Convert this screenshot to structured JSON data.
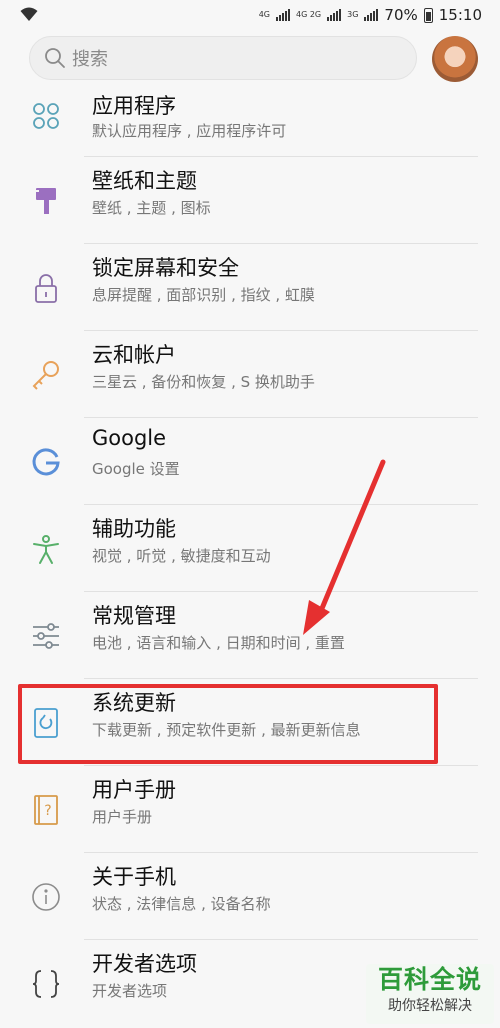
{
  "status_bar": {
    "network_top": "4G",
    "network_2": "4G 2G",
    "network_3": "3G",
    "battery": "70%",
    "time": "15:10"
  },
  "search": {
    "placeholder": "搜索"
  },
  "settings": [
    {
      "title": "应用程序",
      "subtitle": "默认应用程序 , 应用程序许可",
      "icon": "apps-icon"
    },
    {
      "title": "壁纸和主题",
      "subtitle": "壁纸 , 主题 , 图标",
      "icon": "paint-brush-icon"
    },
    {
      "title": "锁定屏幕和安全",
      "subtitle": "息屏提醒 , 面部识别 , 指纹 , 虹膜",
      "icon": "lock-icon"
    },
    {
      "title": "云和帐户",
      "subtitle": "三星云 , 备份和恢复 , S 换机助手",
      "icon": "key-icon"
    },
    {
      "title": "Google",
      "subtitle": "Google 设置",
      "icon": "google-icon"
    },
    {
      "title": "辅助功能",
      "subtitle": "视觉 , 听觉 , 敏捷度和互动",
      "icon": "accessibility-icon"
    },
    {
      "title": "常规管理",
      "subtitle": "电池 , 语言和输入 , 日期和时间 , 重置",
      "icon": "sliders-icon"
    },
    {
      "title": "系统更新",
      "subtitle": "下载更新 , 预定软件更新 , 最新更新信息",
      "icon": "system-update-icon"
    },
    {
      "title": "用户手册",
      "subtitle": "用户手册",
      "icon": "user-manual-icon"
    },
    {
      "title": "关于手机",
      "subtitle": "状态 , 法律信息 , 设备名称",
      "icon": "info-icon"
    },
    {
      "title": "开发者选项",
      "subtitle": "开发者选项",
      "icon": "developer-braces-icon"
    }
  ],
  "colors": {
    "annotation": "#e53030",
    "watermark_green": "#2e9b3a"
  },
  "watermark": {
    "title": "百科全说",
    "subtitle": "助你轻松解决"
  }
}
